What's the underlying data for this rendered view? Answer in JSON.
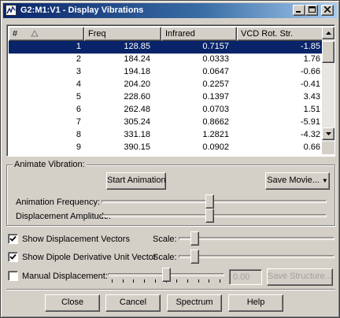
{
  "window": {
    "title": "G2:M1:V1 - Display Vibrations",
    "minimize_icon": "minimize-icon",
    "maximize_icon": "maximize-icon",
    "close_icon": "close-icon"
  },
  "table": {
    "columns": [
      "#",
      "Freq",
      "Infrared",
      "VCD Rot. Str."
    ],
    "rows": [
      {
        "num": "1",
        "freq": "128.85",
        "ir": "0.7157",
        "vcd": "-1.85"
      },
      {
        "num": "2",
        "freq": "184.24",
        "ir": "0.0333",
        "vcd": "1.76"
      },
      {
        "num": "3",
        "freq": "194.18",
        "ir": "0.0647",
        "vcd": "-0.66"
      },
      {
        "num": "4",
        "freq": "204.20",
        "ir": "0.2257",
        "vcd": "-0.41"
      },
      {
        "num": "5",
        "freq": "228.60",
        "ir": "0.1397",
        "vcd": "3.43"
      },
      {
        "num": "6",
        "freq": "262.48",
        "ir": "0.0703",
        "vcd": "1.51"
      },
      {
        "num": "7",
        "freq": "305.24",
        "ir": "0.8662",
        "vcd": "-5.91"
      },
      {
        "num": "8",
        "freq": "331.18",
        "ir": "1.2821",
        "vcd": "-4.32"
      },
      {
        "num": "9",
        "freq": "390.15",
        "ir": "0.0902",
        "vcd": "0.66"
      }
    ],
    "selected_row": 0
  },
  "animate": {
    "group_label": "Animate Vibration:",
    "start_button": "Start Animation",
    "save_movie_button": "Save Movie...",
    "frequency_label": "Animation Frequency:",
    "amplitude_label": "Displacement Amplitude:",
    "frequency_level": 0.48,
    "amplitude_level": 0.48
  },
  "options": {
    "show_vectors_label": "Show Displacement Vectors",
    "show_vectors_checked": true,
    "show_dipole_label": "Show Dipole Derivative Unit Vector",
    "show_dipole_checked": true,
    "scale_label": "Scale:",
    "vectors_scale_level": 0.08,
    "dipole_scale_level": 0.08,
    "manual_label": "Manual Displacement:",
    "manual_checked": false,
    "manual_value": "0.00",
    "manual_level": 0.5,
    "save_structure_button": "Save Structure..."
  },
  "footer": {
    "close": "Close",
    "cancel": "Cancel",
    "spectrum": "Spectrum",
    "help": "Help"
  }
}
